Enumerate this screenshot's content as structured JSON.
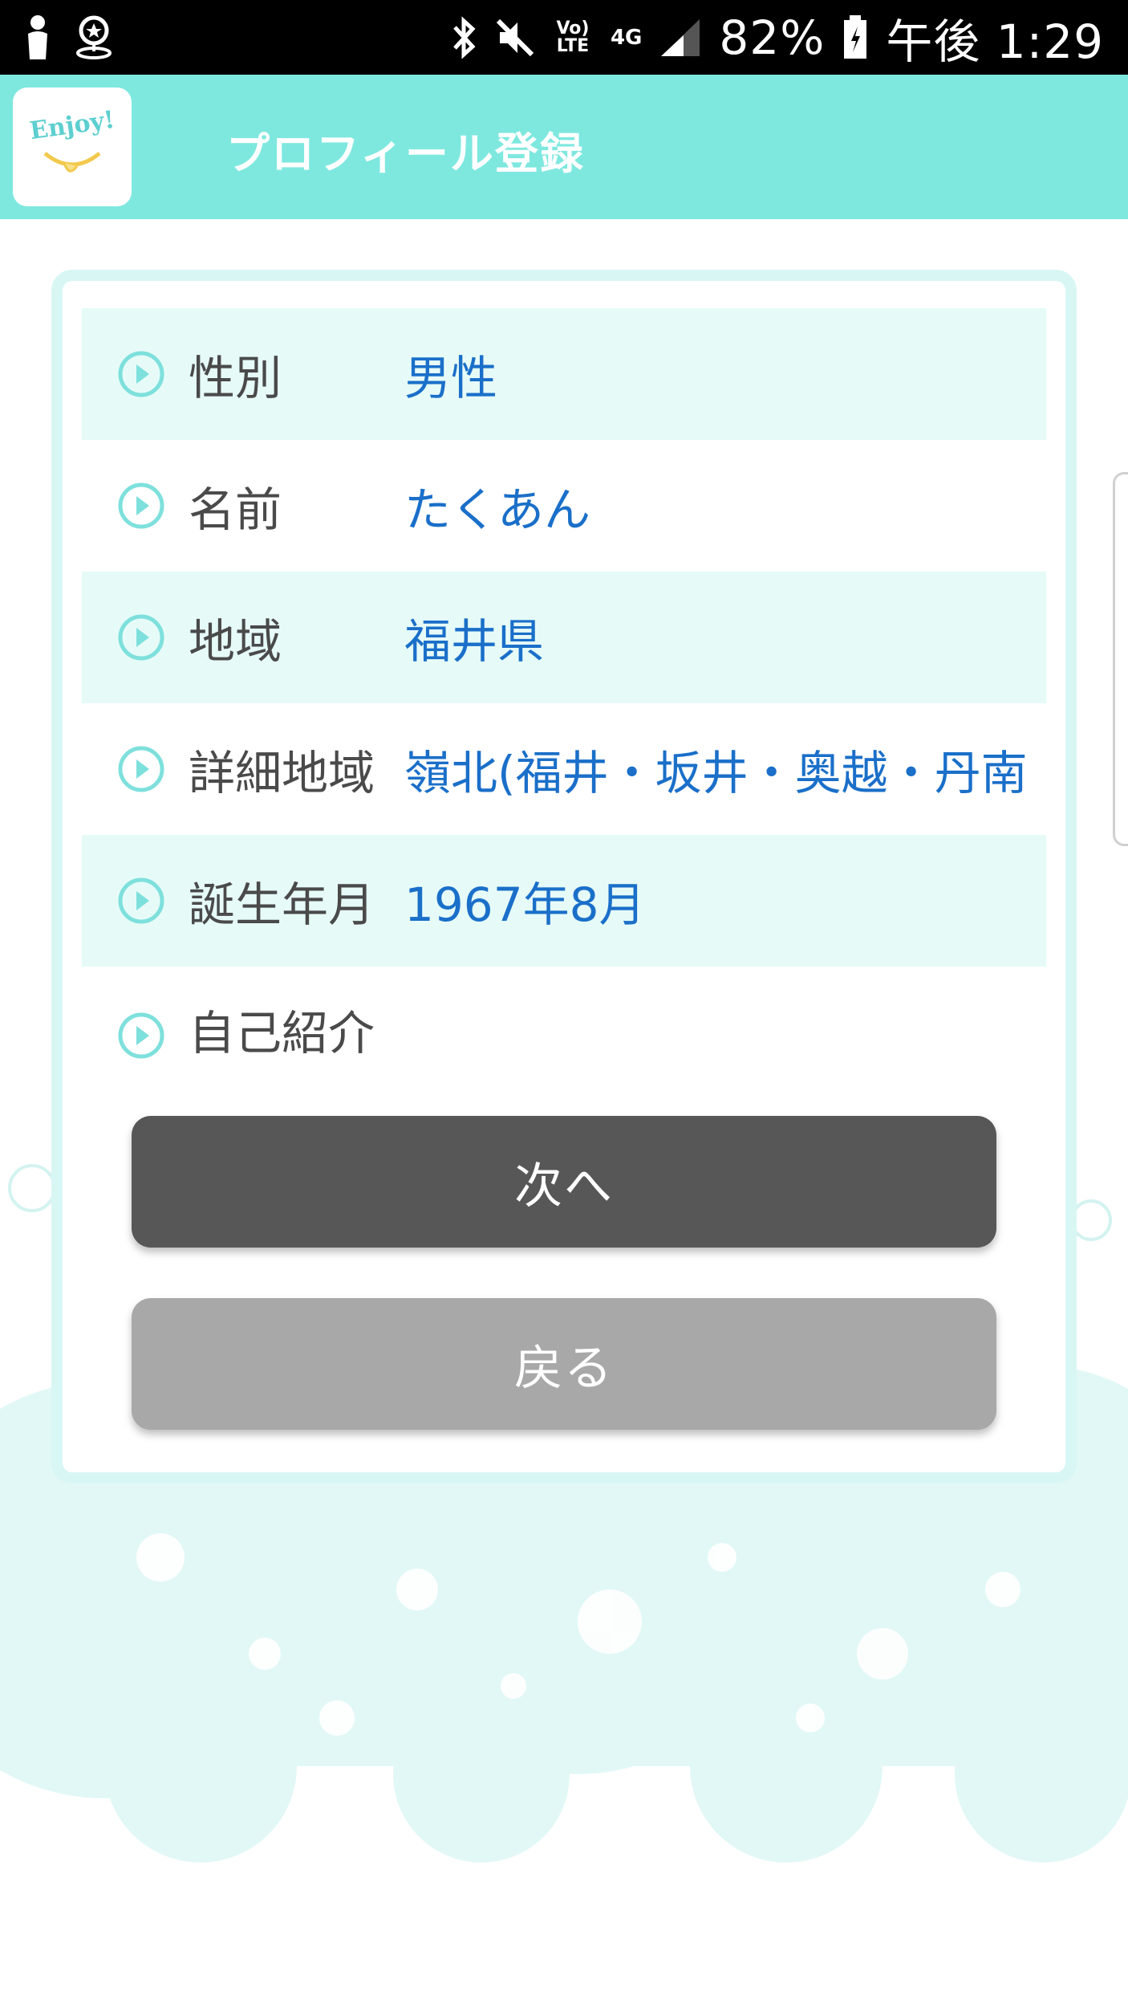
{
  "status_bar": {
    "battery": "82%",
    "time": "午後 1:29",
    "network_volte": "Vo) LTE",
    "network_4g": "4G"
  },
  "app_bar": {
    "logo_text": "Enjoy!",
    "title": "プロフィール登録"
  },
  "profile": {
    "rows": [
      {
        "label": "性別",
        "value": "男性"
      },
      {
        "label": "名前",
        "value": "たくあん"
      },
      {
        "label": "地域",
        "value": "福井県"
      },
      {
        "label": "詳細地域",
        "value": "嶺北(福井・坂井・奥越・丹南"
      },
      {
        "label": "誕生年月",
        "value": "1967年8月"
      },
      {
        "label": "自己紹介",
        "value": ""
      }
    ]
  },
  "buttons": {
    "next": "次へ",
    "back": "戻る"
  },
  "colors": {
    "accent": "#7ee8df",
    "row_shade": "#e6fbf8",
    "value_text": "#1a6fc9",
    "next_button": "#575757",
    "back_button": "#a8a8a8"
  },
  "icons": [
    "person-icon",
    "location-icon",
    "bluetooth-icon",
    "mute-icon",
    "signal-icon",
    "battery-icon",
    "chevron-circle-icon"
  ]
}
